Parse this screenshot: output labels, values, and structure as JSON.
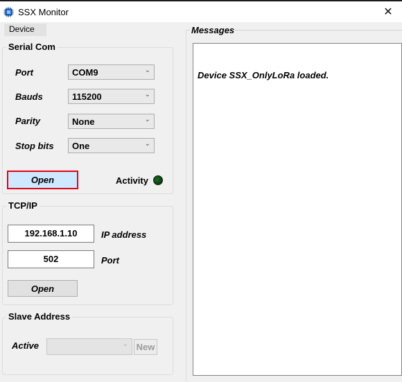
{
  "window": {
    "title": "SSX Monitor",
    "close_glyph": "✕"
  },
  "menu": {
    "items": [
      {
        "label": "Device"
      }
    ]
  },
  "serial": {
    "title": "Serial Com",
    "port": {
      "label": "Port",
      "value": "COM9"
    },
    "bauds": {
      "label": "Bauds",
      "value": "115200"
    },
    "parity": {
      "label": "Parity",
      "value": "None"
    },
    "stop_bits": {
      "label": "Stop bits",
      "value": "One"
    },
    "open_label": "Open",
    "activity_label": "Activity",
    "activity_led_color": "#0b4a10"
  },
  "tcp": {
    "title": "TCP/IP",
    "ip": {
      "value": "192.168.1.10",
      "label": "IP address"
    },
    "port": {
      "value": "502",
      "label": "Port"
    },
    "open_label": "Open"
  },
  "slave": {
    "title": "Slave Address",
    "active_label": "Active",
    "active_value": "",
    "new_label": "New"
  },
  "messages": {
    "title": "Messages",
    "lines": [
      "Device SSX_OnlyLoRa loaded."
    ]
  },
  "colors": {
    "focus_outline": "#e60012",
    "focused_button_bg": "#cde8ff"
  }
}
